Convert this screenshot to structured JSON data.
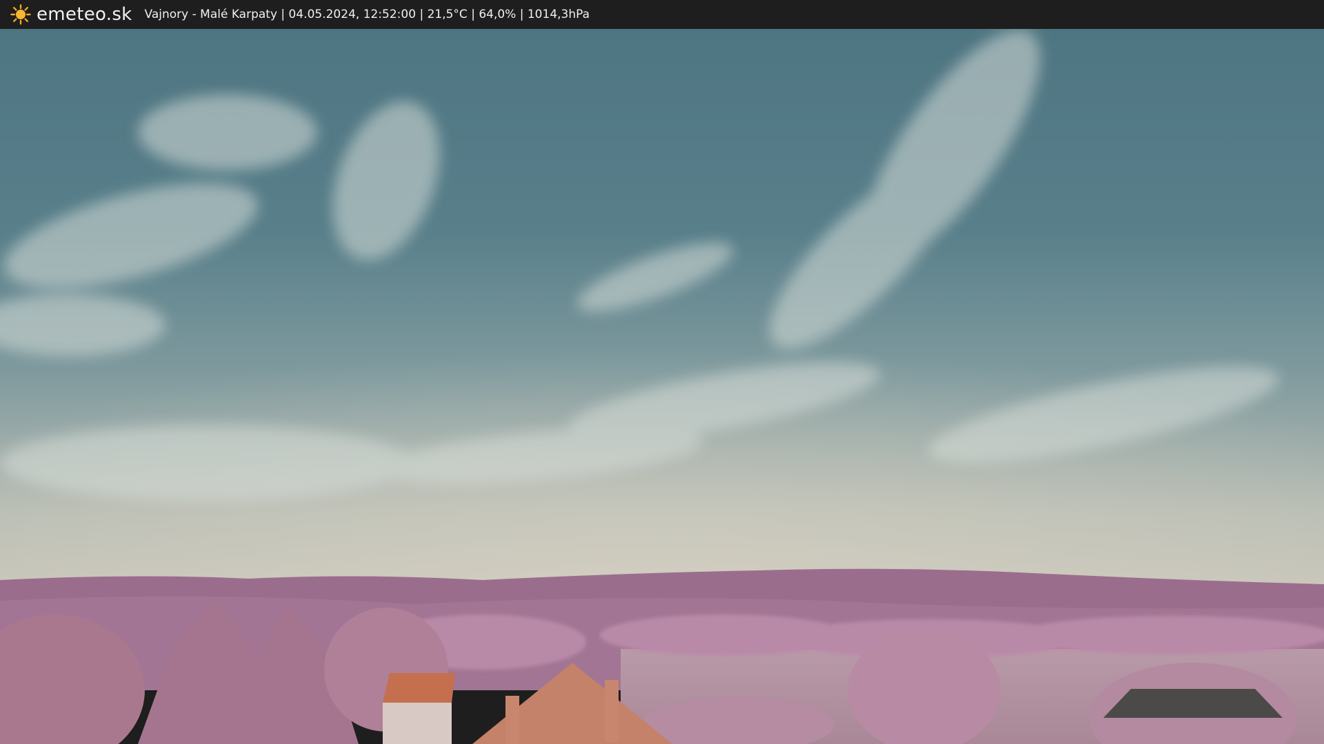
{
  "header": {
    "logo_text": "emeteo.sk",
    "logo_icon": "sun-icon",
    "caption": "Vajnory - Malé Karpaty | 04.05.2024, 12:52:00 | 21,5°C | 64,0% | 1014,3hPa"
  },
  "colors": {
    "bar": "#1e1e1e",
    "sun": "#f5a623",
    "sky_top": "#4a6f7d",
    "sky_horizon": "#c9c7bb",
    "hills": "#9a6d8c",
    "vegetation": "#b98aa8",
    "roof": "#c4704f"
  }
}
